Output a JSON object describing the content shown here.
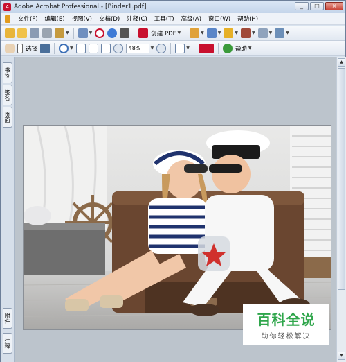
{
  "window": {
    "title": "Adobe Acrobat Professional - [Binder1.pdf]",
    "controls": [
      "_",
      "□",
      "×"
    ]
  },
  "menu": {
    "items": [
      "文件(F)",
      "编辑(E)",
      "视图(V)",
      "文档(D)",
      "注释(C)",
      "工具(T)",
      "高级(A)",
      "窗口(W)",
      "帮助(H)"
    ]
  },
  "toolbar1": {
    "create_pdf_label": "创建 PDF"
  },
  "toolbar2": {
    "select_label": "选择",
    "zoom_value": "48%",
    "help_label": "帮助"
  },
  "leftpane": {
    "tabs": [
      "书签",
      "签名",
      "页面",
      "附件",
      "注释"
    ]
  },
  "watermark": {
    "title": "百科全说",
    "subtitle": "助你轻松解决"
  },
  "colors": {
    "accent": "#c8102e",
    "watermark_green": "#2fa64b"
  }
}
